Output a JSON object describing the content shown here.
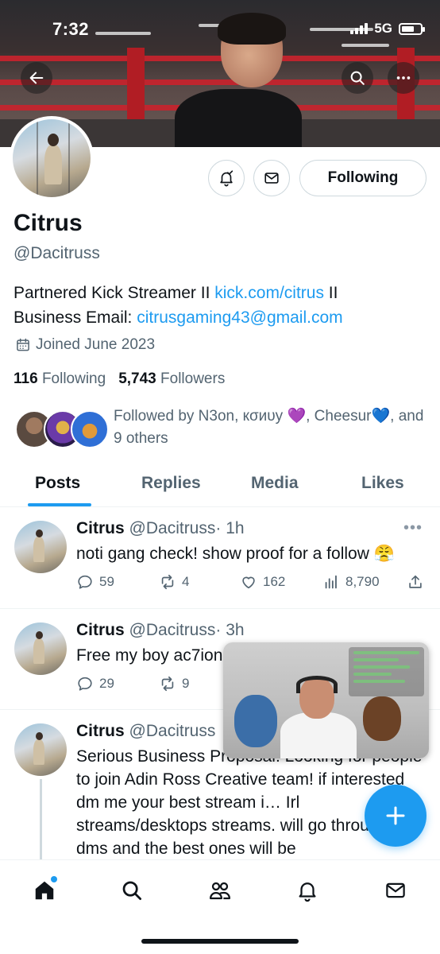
{
  "status_bar": {
    "time": "7:32",
    "network": "5G"
  },
  "profile": {
    "display_name": "Citrus",
    "handle": "@Dacitruss",
    "bio_line1_prefix": "Partnered Kick Streamer II ",
    "bio_link": "kick.com/citrus",
    "bio_line1_suffix": " II",
    "bio_line2_prefix": "Business Email: ",
    "bio_email": "citrusgaming43@gmail.com",
    "joined": "Joined June 2023",
    "following_count": "116",
    "following_label": "Following",
    "followers_count": "5,743",
    "followers_label": "Followers",
    "followed_by": "Followed by N3on, кσиυу 💜, Cheesur💙, and 9 others",
    "follow_button": "Following"
  },
  "tabs": [
    {
      "label": "Posts",
      "active": true
    },
    {
      "label": "Replies",
      "active": false
    },
    {
      "label": "Media",
      "active": false
    },
    {
      "label": "Likes",
      "active": false
    }
  ],
  "posts": [
    {
      "name": "Citrus",
      "handle": "@Dacitruss",
      "time": "· 1h",
      "text": "noti gang check! show proof for a follow 😤",
      "replies": "59",
      "reposts": "4",
      "likes": "162",
      "views": "8,790"
    },
    {
      "name": "Citrus",
      "handle": "@Dacitruss",
      "time": "· 3h",
      "text": "Free my boy ac7ion",
      "replies": "29",
      "reposts": "9"
    },
    {
      "name": "Citrus",
      "handle": "@Dacitruss",
      "text": "Serious Business Proposal: Looking for people to join Adin Ross Creative team! if interested dm me your best stream i… Irl streams/desktops streams. will go through all dms and the best ones will be"
    }
  ],
  "colors": {
    "accent": "#1d9bf0",
    "text": "#0f1419",
    "secondary": "#536471",
    "banner_rope": "#c8232c"
  },
  "icons": {
    "back": "arrow-left-icon",
    "search": "search-icon",
    "more": "more-icon",
    "notify": "bell-check-icon",
    "message": "mail-icon",
    "calendar": "calendar-icon",
    "compose": "plus-icon"
  },
  "bottom_nav": [
    "home",
    "search",
    "communities",
    "notifications",
    "messages"
  ]
}
